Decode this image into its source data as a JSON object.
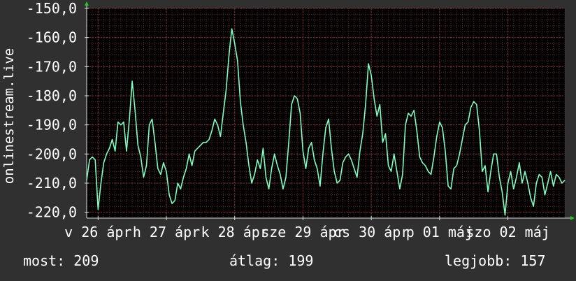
{
  "chart_data": {
    "type": "line",
    "ylabel": "onlinestream.live",
    "ylim": [
      -222,
      -150
    ],
    "yticks": [
      -150,
      -160,
      -170,
      -180,
      -190,
      -200,
      -210,
      -220
    ],
    "ytick_labels": [
      "-150,0",
      "-160,0",
      "-170,0",
      "-180,0",
      "-190,0",
      "-200,0",
      "-210,0",
      "-220,0"
    ],
    "x_range": [
      0,
      168
    ],
    "x_ticks": [
      {
        "at": 4,
        "label": "v 26 ápr"
      },
      {
        "at": 28,
        "label": "h 27 ápr"
      },
      {
        "at": 52,
        "label": "k 28 ápr"
      },
      {
        "at": 76,
        "label": "sze 29 ápr"
      },
      {
        "at": 100,
        "label": "cs 30 ápr"
      },
      {
        "at": 124,
        "label": "p 01 máj"
      },
      {
        "at": 148,
        "label": "szo 02 máj"
      }
    ],
    "grid": true,
    "colors": {
      "line": "#7dffc0",
      "plot_bg": "#000000",
      "grid": "#6a2a2a",
      "page_bg": "#303030"
    },
    "series": [
      {
        "values": [
          -209,
          -202,
          -201,
          -202,
          -219,
          -210,
          -203,
          -200,
          -198,
          -195,
          -199,
          -189,
          -190,
          -189,
          -199,
          -188,
          -175,
          -185,
          -197,
          -201,
          -208,
          -204,
          -190,
          -188,
          -196,
          -205,
          -207,
          -203,
          -206,
          -214,
          -217,
          -216,
          -210,
          -212,
          -208,
          -205,
          -200,
          -204,
          -199,
          -198,
          -197,
          -196,
          -196,
          -195,
          -192,
          -188,
          -190,
          -194,
          -186,
          -178,
          -166,
          -157,
          -162,
          -168,
          -182,
          -190,
          -196,
          -204,
          -210,
          -207,
          -202,
          -205,
          -198,
          -208,
          -212,
          -205,
          -200,
          -204,
          -207,
          -212,
          -208,
          -196,
          -183,
          -180,
          -181,
          -186,
          -199,
          -205,
          -198,
          -196,
          -202,
          -205,
          -211,
          -200,
          -191,
          -188,
          -198,
          -206,
          -210,
          -209,
          -203,
          -201,
          -200,
          -202,
          -205,
          -208,
          -199,
          -193,
          -183,
          -169,
          -173,
          -181,
          -187,
          -183,
          -196,
          -193,
          -204,
          -206,
          -200,
          -206,
          -212,
          -207,
          -190,
          -186,
          -187,
          -185,
          -192,
          -201,
          -203,
          -204,
          -206,
          -207,
          -201,
          -194,
          -189,
          -191,
          -199,
          -211,
          -212,
          -205,
          -204,
          -200,
          -195,
          -190,
          -189,
          -184,
          -182,
          -183,
          -192,
          -206,
          -204,
          -213,
          -206,
          -200,
          -200,
          -208,
          -213,
          -221,
          -210,
          -206,
          -212,
          -208,
          -203,
          -210,
          -206,
          -210,
          -215,
          -218,
          -210,
          -207,
          -208,
          -214,
          -210,
          -206,
          -211,
          -207,
          -208,
          -210,
          -209
        ]
      }
    ]
  },
  "stats": {
    "now": "most: 209",
    "avg": "átlag: 199",
    "best": "legjobb: 157"
  }
}
